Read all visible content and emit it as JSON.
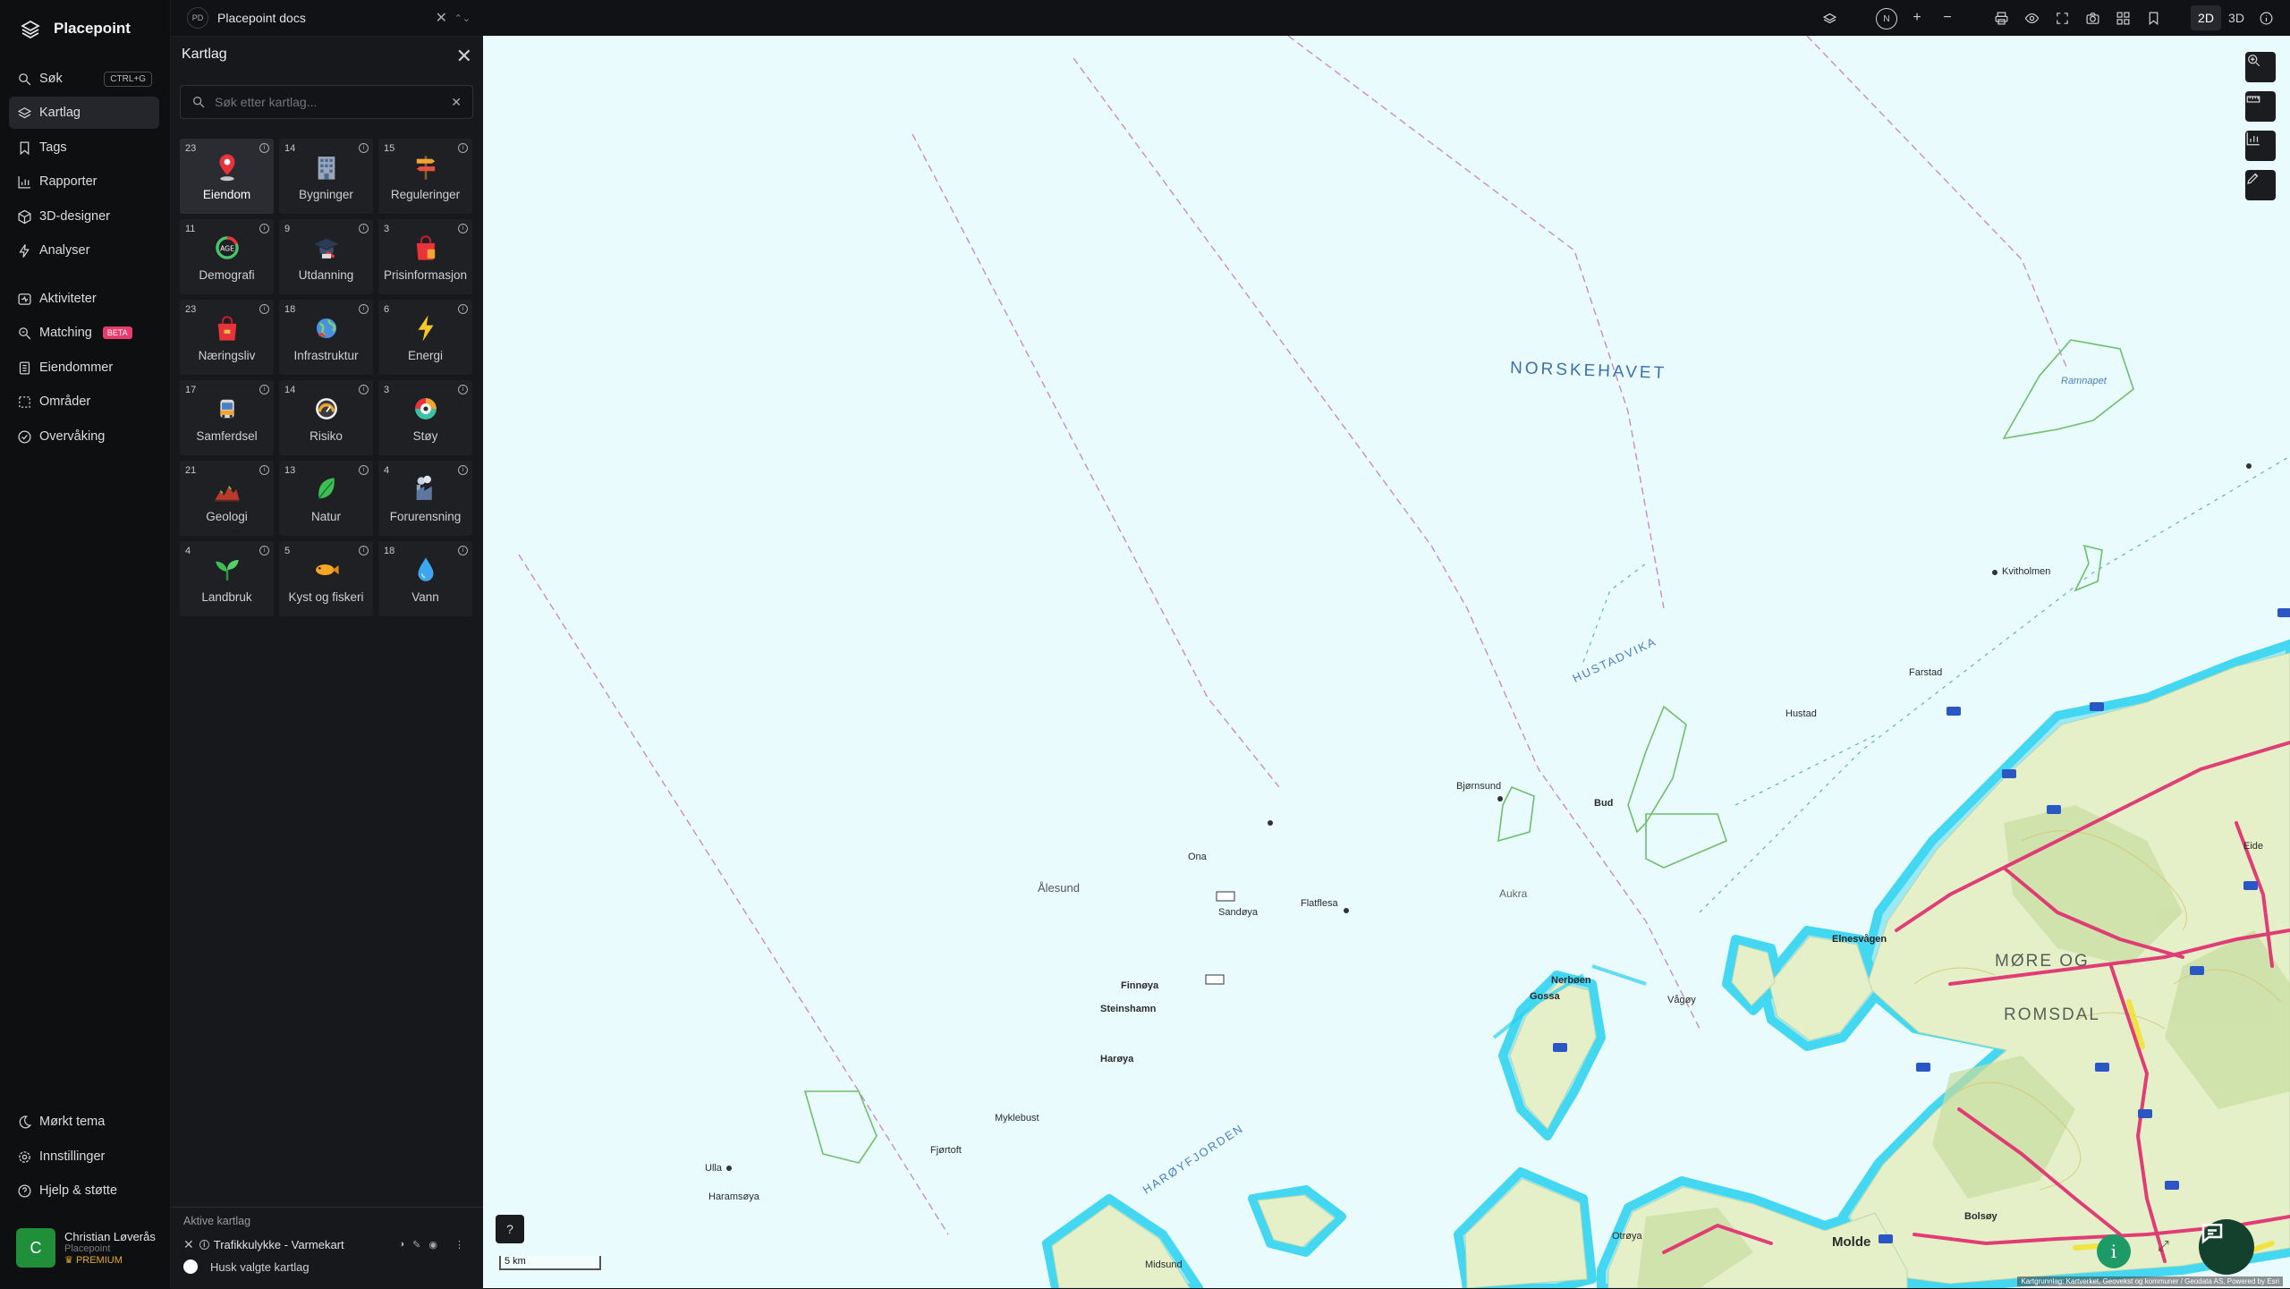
{
  "app": {
    "name": "Placepoint"
  },
  "nav": {
    "items": [
      {
        "label": "Søk",
        "shortcut": "CTRL+G",
        "icon": "search-icon"
      },
      {
        "label": "Kartlag",
        "icon": "layers-icon",
        "active": true
      },
      {
        "label": "Tags",
        "icon": "bookmark-icon"
      },
      {
        "label": "Rapporter",
        "icon": "bar-chart-icon"
      },
      {
        "label": "3D-designer",
        "icon": "cube-icon"
      },
      {
        "label": "Analyser",
        "icon": "bolt-icon"
      },
      {
        "label": "Aktiviteter",
        "icon": "activity-icon"
      },
      {
        "label": "Matching",
        "badge": "BETA",
        "icon": "match-icon"
      },
      {
        "label": "Eiendommer",
        "icon": "building-list-icon"
      },
      {
        "label": "Områder",
        "icon": "area-icon"
      },
      {
        "label": "Overvåking",
        "icon": "monitor-icon"
      }
    ],
    "bottom": [
      {
        "label": "Mørkt tema",
        "icon": "moon-icon"
      },
      {
        "label": "Innstillinger",
        "icon": "gear-icon"
      },
      {
        "label": "Hjelp & støtte",
        "icon": "help-icon"
      }
    ],
    "user": {
      "initial": "C",
      "name": "Christian Løverås",
      "org": "Placepoint",
      "plan": "PREMIUM"
    }
  },
  "docbar": {
    "badge": "PD",
    "title": "Placepoint docs"
  },
  "panel": {
    "title": "Kartlag",
    "search_placeholder": "Søk etter kartlag...",
    "tiles": [
      {
        "count": "23",
        "label": "Eiendom",
        "icon": "pin-icon",
        "selected": true
      },
      {
        "count": "14",
        "label": "Bygninger",
        "icon": "office-building-icon"
      },
      {
        "count": "15",
        "label": "Reguleringer",
        "icon": "signpost-icon"
      },
      {
        "count": "11",
        "label": "Demografi",
        "icon": "age-gauge-icon"
      },
      {
        "count": "9",
        "label": "Utdanning",
        "icon": "graduation-cap-icon"
      },
      {
        "count": "3",
        "label": "Prisinformasjon",
        "icon": "shopping-bag-icon"
      },
      {
        "count": "23",
        "label": "Næringsliv",
        "icon": "briefcase-icon"
      },
      {
        "count": "18",
        "label": "Infrastruktur",
        "icon": "globe-icon"
      },
      {
        "count": "6",
        "label": "Energi",
        "icon": "lightning-icon"
      },
      {
        "count": "17",
        "label": "Samferdsel",
        "icon": "bus-icon"
      },
      {
        "count": "14",
        "label": "Risiko",
        "icon": "risk-gauge-icon"
      },
      {
        "count": "3",
        "label": "Støy",
        "icon": "noise-gauge-icon"
      },
      {
        "count": "21",
        "label": "Geologi",
        "icon": "terrain-icon"
      },
      {
        "count": "13",
        "label": "Natur",
        "icon": "leaf-icon"
      },
      {
        "count": "4",
        "label": "Forurensning",
        "icon": "factory-icon"
      },
      {
        "count": "4",
        "label": "Landbruk",
        "icon": "sprout-icon"
      },
      {
        "count": "5",
        "label": "Kyst og fiskeri",
        "icon": "fish-icon"
      },
      {
        "count": "18",
        "label": "Vann",
        "icon": "water-drop-icon"
      }
    ],
    "active": {
      "title": "Aktive kartlag",
      "layers": [
        {
          "label": "Trafikkulykke - Varmekart"
        }
      ],
      "remember_label": "Husk valgte kartlag"
    }
  },
  "topbar": {
    "compass": "N",
    "mode_2d": "2D",
    "mode_3d": "3D",
    "active_mode": "2D"
  },
  "map": {
    "sea_labels": [
      "NORSKEHAVET",
      "HUSTADVIKA",
      "HARØYFJORDEN"
    ],
    "region_labels": [
      "MØRE OG",
      "ROMSDAL"
    ],
    "place_labels": [
      "Ålesund",
      "Molde",
      "Aukra",
      "Bud",
      "Hustad",
      "Farstad",
      "Eide",
      "Elnesvågen",
      "Harøya",
      "Finnøya",
      "Steinshamn",
      "Myklebust",
      "Fjørtoft",
      "Gossa",
      "Nerbøen",
      "Vågøy",
      "Sandøya",
      "Flatflesa",
      "Bjørnsund",
      "Ona",
      "Ulla",
      "Haramsøya",
      "Midsund",
      "Otrøya",
      "Bolsøy",
      "Kvitholmen",
      "Ramnapet"
    ],
    "scale_label": "5 km",
    "attribution": "Kartgrunnlag: Kartverket, Geovekst og kommuner / Geodata AS, Powered by Esri"
  },
  "colors": {
    "accent": "#e83b6e",
    "premium": "#e3a82b",
    "avatar": "#1f8f3a",
    "map_sea": "#e9fbfd",
    "land": "#e6f0c8",
    "coast_glow": "#27d1f0",
    "road": "#e02a6e"
  }
}
